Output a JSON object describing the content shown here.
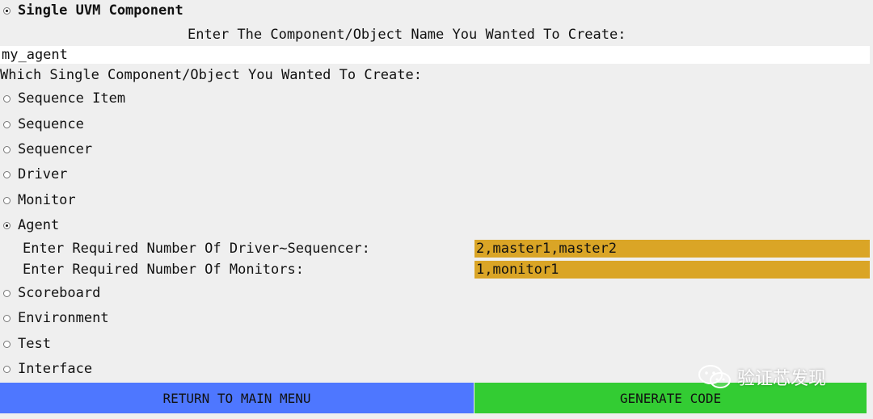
{
  "mode": {
    "label": "Single UVM Component",
    "selected": true
  },
  "name_prompt": "Enter The Component/Object Name You Wanted To Create:",
  "name_value": "my_agent",
  "type_prompt": "Which Single Component/Object You Wanted To Create:",
  "options": [
    {
      "label": "Sequence Item",
      "selected": false
    },
    {
      "label": "Sequence",
      "selected": false
    },
    {
      "label": "Sequencer",
      "selected": false
    },
    {
      "label": "Driver",
      "selected": false
    },
    {
      "label": "Monitor",
      "selected": false
    },
    {
      "label": "Agent",
      "selected": true
    },
    {
      "label": "Scoreboard",
      "selected": false
    },
    {
      "label": "Environment",
      "selected": false
    },
    {
      "label": "Test",
      "selected": false
    },
    {
      "label": "Interface",
      "selected": false
    }
  ],
  "agent_fields": {
    "driver_sequencer_label": "Enter Required Number Of Driver~Sequencer:",
    "driver_sequencer_value": "2,master1,master2",
    "monitors_label": "Enter Required Number Of Monitors:",
    "monitors_value": "1,monitor1"
  },
  "buttons": {
    "return_label": "RETURN TO MAIN MENU",
    "generate_label": "GENERATE CODE"
  },
  "watermark": "验证芯发现",
  "colors": {
    "background": "#efefef",
    "field_gold": "#daa526",
    "return_blue": "#4e77ff",
    "generate_green": "#33cc33"
  }
}
